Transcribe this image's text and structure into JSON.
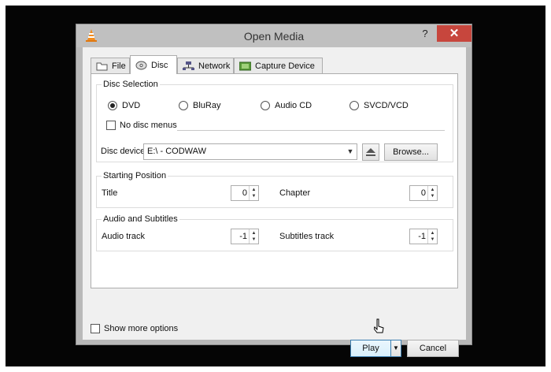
{
  "window": {
    "title": "Open Media",
    "help_label": "?",
    "close_label": "✕"
  },
  "tabs": [
    {
      "label": "File",
      "icon": "folder-icon",
      "active": false
    },
    {
      "label": "Disc",
      "icon": "disc-icon",
      "active": true
    },
    {
      "label": "Network",
      "icon": "network-icon",
      "active": false
    },
    {
      "label": "Capture Device",
      "icon": "capture-device-icon",
      "active": false
    }
  ],
  "disc_selection": {
    "label": "Disc Selection",
    "options": [
      {
        "label": "DVD",
        "checked": true
      },
      {
        "label": "BluRay",
        "checked": false
      },
      {
        "label": "Audio CD",
        "checked": false
      },
      {
        "label": "SVCD/VCD",
        "checked": false
      }
    ],
    "no_disc_menus": {
      "label": "No disc menus",
      "checked": false
    },
    "device_label": "Disc device",
    "device_value": "E:\\ - CODWAW",
    "browse_label": "Browse..."
  },
  "starting_position": {
    "label": "Starting Position",
    "title_label": "Title",
    "title_value": "0",
    "chapter_label": "Chapter",
    "chapter_value": "0"
  },
  "audio_subtitles": {
    "label": "Audio and Subtitles",
    "audio_label": "Audio track",
    "audio_value": "-1",
    "subtitles_label": "Subtitles track",
    "subtitles_value": "-1"
  },
  "footer": {
    "show_more_label": "Show more options",
    "play_label": "Play",
    "cancel_label": "Cancel"
  },
  "colors": {
    "close_button": "#c7463d",
    "vlc_orange": "#f28b1c"
  }
}
